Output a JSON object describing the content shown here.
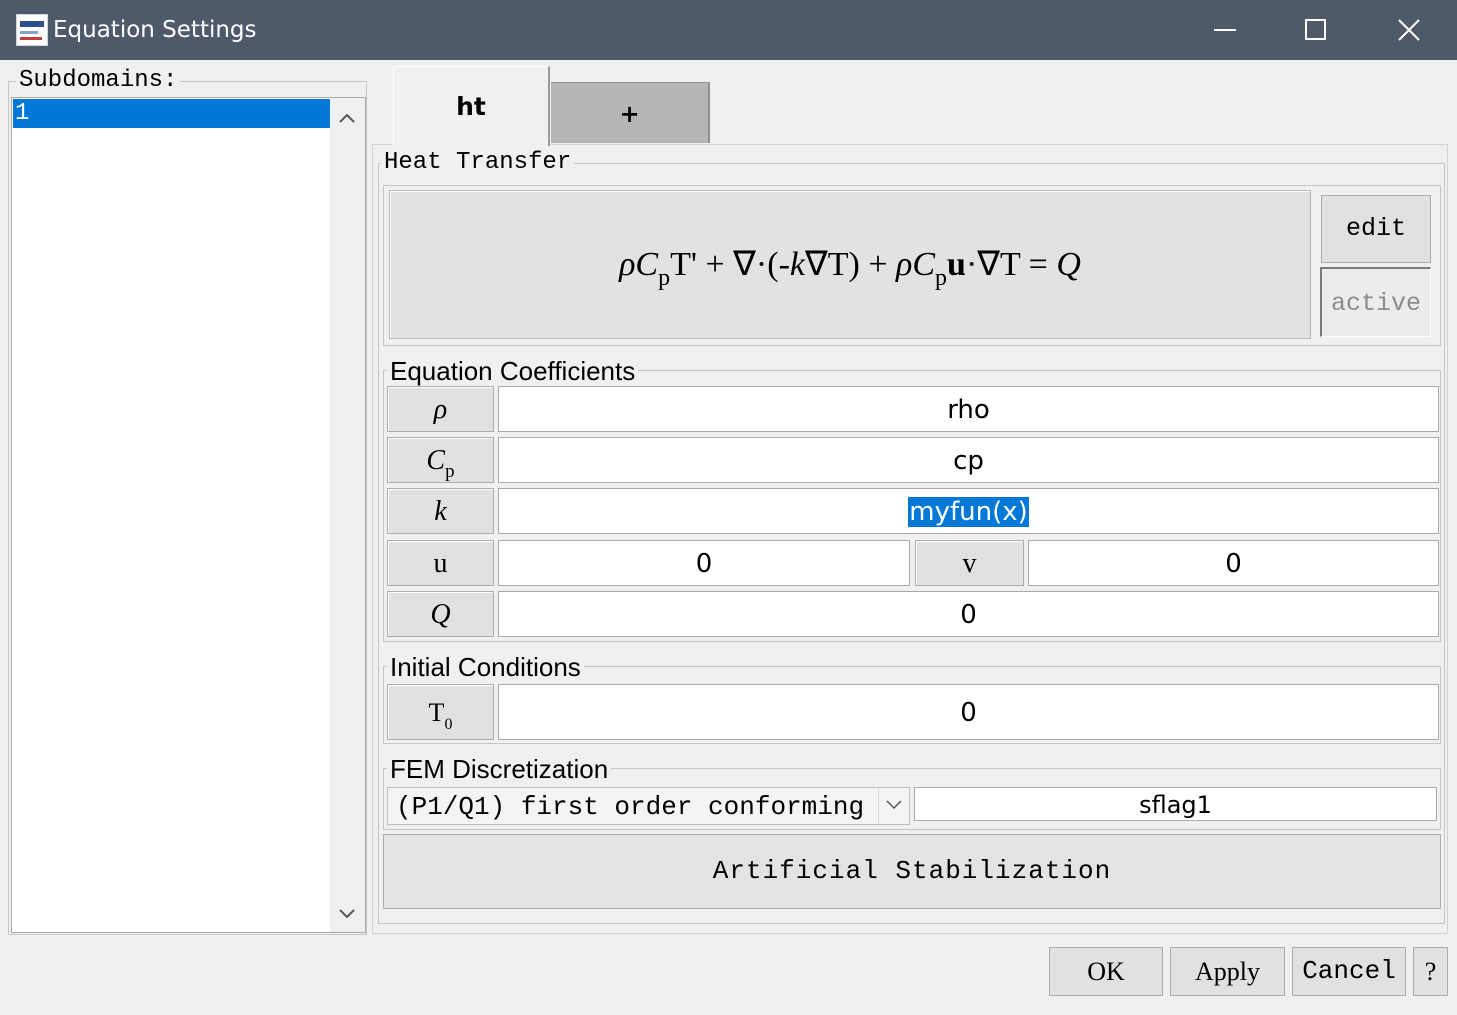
{
  "window": {
    "title": "Equation Settings",
    "controls": {
      "minimize": "minimize-icon",
      "maximize": "maximize-icon",
      "close": "close-icon"
    }
  },
  "subdomains": {
    "label": "Subdomains:",
    "items": [
      "1"
    ],
    "selected": "1"
  },
  "tabs": [
    {
      "label": "ht",
      "active": true
    },
    {
      "label": "+",
      "active": false
    }
  ],
  "physics": {
    "title": "Heat Transfer",
    "equation": {
      "t1_rho": "ρ",
      "t1_C": "C",
      "t1_sub": "p",
      "t1_rest": "T' + ∇·(-",
      "k": "k",
      "t2_rest": "∇T) + ",
      "t3_rho": "ρ",
      "t3_C": "C",
      "t3_sub": "p",
      "u": "u",
      "t4_rest": "·∇T = ",
      "Q": "Q"
    },
    "edit_label": "edit",
    "active_label": "active"
  },
  "coefficients": {
    "title": "Equation Coefficients",
    "rho": {
      "symbol": "ρ",
      "value": "rho"
    },
    "cp": {
      "symbol": "C",
      "sub": "p",
      "value": "cp"
    },
    "k": {
      "symbol": "k",
      "value": "myfun(x)"
    },
    "u": {
      "symbol": "u",
      "value": "0"
    },
    "v": {
      "symbol": "v",
      "value": "0"
    },
    "Q": {
      "symbol": "Q",
      "value": "0"
    }
  },
  "initial_conditions": {
    "title": "Initial Conditions",
    "T0": {
      "symbol": "T",
      "sub": "0",
      "value": "0"
    }
  },
  "fem": {
    "title": "FEM Discretization",
    "element": "(P1/Q1) first order conforming",
    "flag": "sflag1"
  },
  "stabilization_label": "Artificial Stabilization",
  "buttons": {
    "ok": "OK",
    "apply": "Apply",
    "cancel": "Cancel",
    "help": "?"
  },
  "colors": {
    "titlebar": "#4e5a6a",
    "selection": "#0078d7",
    "dialog_bg": "#f0f0f0"
  }
}
